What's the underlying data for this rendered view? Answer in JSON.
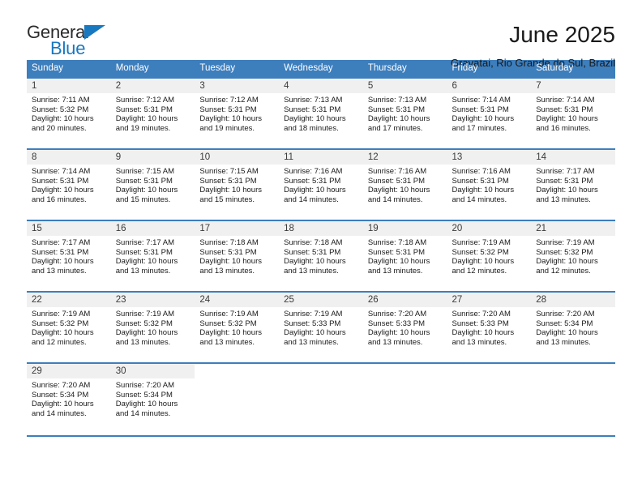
{
  "logo": {
    "word_one": "General",
    "word_two": "Blue",
    "triangle_color": "#1878c0"
  },
  "header": {
    "title": "June 2025",
    "subtitle": "Gravatai, Rio Grande do Sul, Brazil"
  },
  "theme": {
    "header_blue": "#3d7ebd",
    "daynum_gray": "#f0f0f0"
  },
  "calendar": {
    "day_headers": [
      "Sunday",
      "Monday",
      "Tuesday",
      "Wednesday",
      "Thursday",
      "Friday",
      "Saturday"
    ],
    "weeks": [
      [
        {
          "day": "1",
          "sunrise": "Sunrise: 7:11 AM",
          "sunset": "Sunset: 5:32 PM",
          "daylight_1": "Daylight: 10 hours",
          "daylight_2": "and 20 minutes."
        },
        {
          "day": "2",
          "sunrise": "Sunrise: 7:12 AM",
          "sunset": "Sunset: 5:31 PM",
          "daylight_1": "Daylight: 10 hours",
          "daylight_2": "and 19 minutes."
        },
        {
          "day": "3",
          "sunrise": "Sunrise: 7:12 AM",
          "sunset": "Sunset: 5:31 PM",
          "daylight_1": "Daylight: 10 hours",
          "daylight_2": "and 19 minutes."
        },
        {
          "day": "4",
          "sunrise": "Sunrise: 7:13 AM",
          "sunset": "Sunset: 5:31 PM",
          "daylight_1": "Daylight: 10 hours",
          "daylight_2": "and 18 minutes."
        },
        {
          "day": "5",
          "sunrise": "Sunrise: 7:13 AM",
          "sunset": "Sunset: 5:31 PM",
          "daylight_1": "Daylight: 10 hours",
          "daylight_2": "and 17 minutes."
        },
        {
          "day": "6",
          "sunrise": "Sunrise: 7:14 AM",
          "sunset": "Sunset: 5:31 PM",
          "daylight_1": "Daylight: 10 hours",
          "daylight_2": "and 17 minutes."
        },
        {
          "day": "7",
          "sunrise": "Sunrise: 7:14 AM",
          "sunset": "Sunset: 5:31 PM",
          "daylight_1": "Daylight: 10 hours",
          "daylight_2": "and 16 minutes."
        }
      ],
      [
        {
          "day": "8",
          "sunrise": "Sunrise: 7:14 AM",
          "sunset": "Sunset: 5:31 PM",
          "daylight_1": "Daylight: 10 hours",
          "daylight_2": "and 16 minutes."
        },
        {
          "day": "9",
          "sunrise": "Sunrise: 7:15 AM",
          "sunset": "Sunset: 5:31 PM",
          "daylight_1": "Daylight: 10 hours",
          "daylight_2": "and 15 minutes."
        },
        {
          "day": "10",
          "sunrise": "Sunrise: 7:15 AM",
          "sunset": "Sunset: 5:31 PM",
          "daylight_1": "Daylight: 10 hours",
          "daylight_2": "and 15 minutes."
        },
        {
          "day": "11",
          "sunrise": "Sunrise: 7:16 AM",
          "sunset": "Sunset: 5:31 PM",
          "daylight_1": "Daylight: 10 hours",
          "daylight_2": "and 14 minutes."
        },
        {
          "day": "12",
          "sunrise": "Sunrise: 7:16 AM",
          "sunset": "Sunset: 5:31 PM",
          "daylight_1": "Daylight: 10 hours",
          "daylight_2": "and 14 minutes."
        },
        {
          "day": "13",
          "sunrise": "Sunrise: 7:16 AM",
          "sunset": "Sunset: 5:31 PM",
          "daylight_1": "Daylight: 10 hours",
          "daylight_2": "and 14 minutes."
        },
        {
          "day": "14",
          "sunrise": "Sunrise: 7:17 AM",
          "sunset": "Sunset: 5:31 PM",
          "daylight_1": "Daylight: 10 hours",
          "daylight_2": "and 13 minutes."
        }
      ],
      [
        {
          "day": "15",
          "sunrise": "Sunrise: 7:17 AM",
          "sunset": "Sunset: 5:31 PM",
          "daylight_1": "Daylight: 10 hours",
          "daylight_2": "and 13 minutes."
        },
        {
          "day": "16",
          "sunrise": "Sunrise: 7:17 AM",
          "sunset": "Sunset: 5:31 PM",
          "daylight_1": "Daylight: 10 hours",
          "daylight_2": "and 13 minutes."
        },
        {
          "day": "17",
          "sunrise": "Sunrise: 7:18 AM",
          "sunset": "Sunset: 5:31 PM",
          "daylight_1": "Daylight: 10 hours",
          "daylight_2": "and 13 minutes."
        },
        {
          "day": "18",
          "sunrise": "Sunrise: 7:18 AM",
          "sunset": "Sunset: 5:31 PM",
          "daylight_1": "Daylight: 10 hours",
          "daylight_2": "and 13 minutes."
        },
        {
          "day": "19",
          "sunrise": "Sunrise: 7:18 AM",
          "sunset": "Sunset: 5:31 PM",
          "daylight_1": "Daylight: 10 hours",
          "daylight_2": "and 13 minutes."
        },
        {
          "day": "20",
          "sunrise": "Sunrise: 7:19 AM",
          "sunset": "Sunset: 5:32 PM",
          "daylight_1": "Daylight: 10 hours",
          "daylight_2": "and 12 minutes."
        },
        {
          "day": "21",
          "sunrise": "Sunrise: 7:19 AM",
          "sunset": "Sunset: 5:32 PM",
          "daylight_1": "Daylight: 10 hours",
          "daylight_2": "and 12 minutes."
        }
      ],
      [
        {
          "day": "22",
          "sunrise": "Sunrise: 7:19 AM",
          "sunset": "Sunset: 5:32 PM",
          "daylight_1": "Daylight: 10 hours",
          "daylight_2": "and 12 minutes."
        },
        {
          "day": "23",
          "sunrise": "Sunrise: 7:19 AM",
          "sunset": "Sunset: 5:32 PM",
          "daylight_1": "Daylight: 10 hours",
          "daylight_2": "and 13 minutes."
        },
        {
          "day": "24",
          "sunrise": "Sunrise: 7:19 AM",
          "sunset": "Sunset: 5:32 PM",
          "daylight_1": "Daylight: 10 hours",
          "daylight_2": "and 13 minutes."
        },
        {
          "day": "25",
          "sunrise": "Sunrise: 7:19 AM",
          "sunset": "Sunset: 5:33 PM",
          "daylight_1": "Daylight: 10 hours",
          "daylight_2": "and 13 minutes."
        },
        {
          "day": "26",
          "sunrise": "Sunrise: 7:20 AM",
          "sunset": "Sunset: 5:33 PM",
          "daylight_1": "Daylight: 10 hours",
          "daylight_2": "and 13 minutes."
        },
        {
          "day": "27",
          "sunrise": "Sunrise: 7:20 AM",
          "sunset": "Sunset: 5:33 PM",
          "daylight_1": "Daylight: 10 hours",
          "daylight_2": "and 13 minutes."
        },
        {
          "day": "28",
          "sunrise": "Sunrise: 7:20 AM",
          "sunset": "Sunset: 5:34 PM",
          "daylight_1": "Daylight: 10 hours",
          "daylight_2": "and 13 minutes."
        }
      ],
      [
        {
          "day": "29",
          "sunrise": "Sunrise: 7:20 AM",
          "sunset": "Sunset: 5:34 PM",
          "daylight_1": "Daylight: 10 hours",
          "daylight_2": "and 14 minutes."
        },
        {
          "day": "30",
          "sunrise": "Sunrise: 7:20 AM",
          "sunset": "Sunset: 5:34 PM",
          "daylight_1": "Daylight: 10 hours",
          "daylight_2": "and 14 minutes."
        },
        {
          "day": "",
          "sunrise": "",
          "sunset": "",
          "daylight_1": "",
          "daylight_2": ""
        },
        {
          "day": "",
          "sunrise": "",
          "sunset": "",
          "daylight_1": "",
          "daylight_2": ""
        },
        {
          "day": "",
          "sunrise": "",
          "sunset": "",
          "daylight_1": "",
          "daylight_2": ""
        },
        {
          "day": "",
          "sunrise": "",
          "sunset": "",
          "daylight_1": "",
          "daylight_2": ""
        },
        {
          "day": "",
          "sunrise": "",
          "sunset": "",
          "daylight_1": "",
          "daylight_2": ""
        }
      ]
    ]
  }
}
